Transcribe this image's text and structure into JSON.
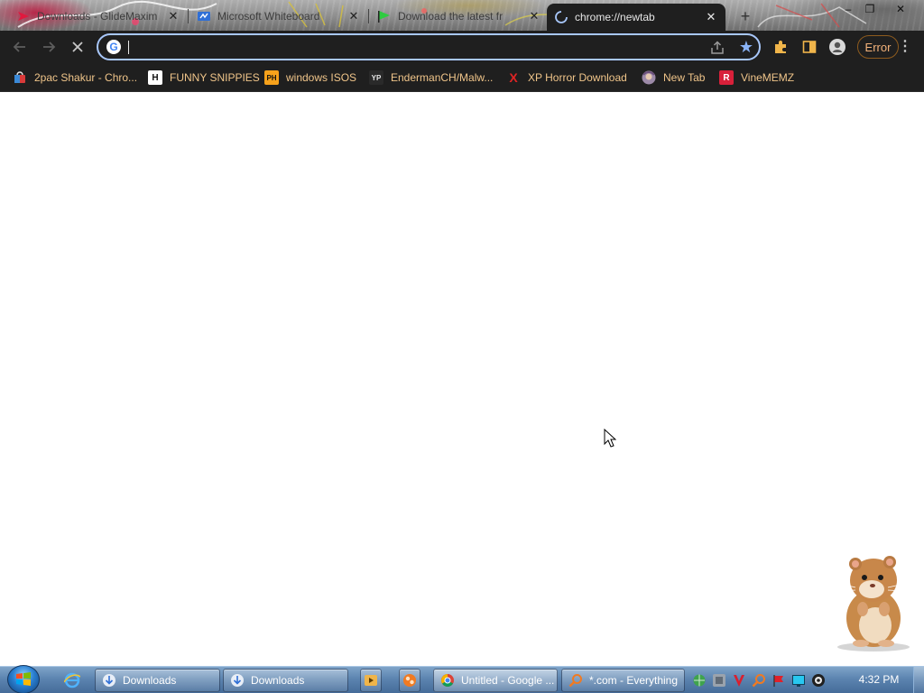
{
  "browser": {
    "tabs": [
      {
        "title": "Downloads - GlideMaxim",
        "active": false
      },
      {
        "title": "Microsoft Whiteboard",
        "active": false
      },
      {
        "title": "Download the latest fr",
        "active": false
      },
      {
        "title": "chrome://newtab",
        "active": true
      }
    ],
    "new_tab_label": "+",
    "window_controls": {
      "minimize": "–",
      "maximize": "❐",
      "close": "✕"
    },
    "omnibox": {
      "value": "",
      "placeholder": ""
    },
    "profile_error_label": "Error",
    "bookmarks": [
      {
        "label": "2pac Shakur - Chro...",
        "icon_text": ""
      },
      {
        "label": "FUNNY SNIPPIES",
        "icon_text": "H"
      },
      {
        "label": "windows ISOS",
        "icon_text": "PH"
      },
      {
        "label": "EndermanCH/Malw...",
        "icon_text": "YP"
      },
      {
        "label": "XP Horror Download",
        "icon_text": "X"
      },
      {
        "label": "New Tab",
        "icon_text": ""
      },
      {
        "label": "VineMEMZ",
        "icon_text": "R"
      }
    ]
  },
  "taskbar": {
    "tasks": [
      {
        "label": "Downloads"
      },
      {
        "label": "Downloads"
      },
      {
        "label": "Untitled - Google ..."
      },
      {
        "label": "*.com - Everything"
      }
    ],
    "clock": "4:32 PM"
  },
  "colors": {
    "chrome_dark": "#1f1f1f",
    "omnibox_focus": "#a8c7fa",
    "bookmark_text": "#f0c58a",
    "error_text": "#f3b27a",
    "taskbar": "#5c84b0"
  }
}
